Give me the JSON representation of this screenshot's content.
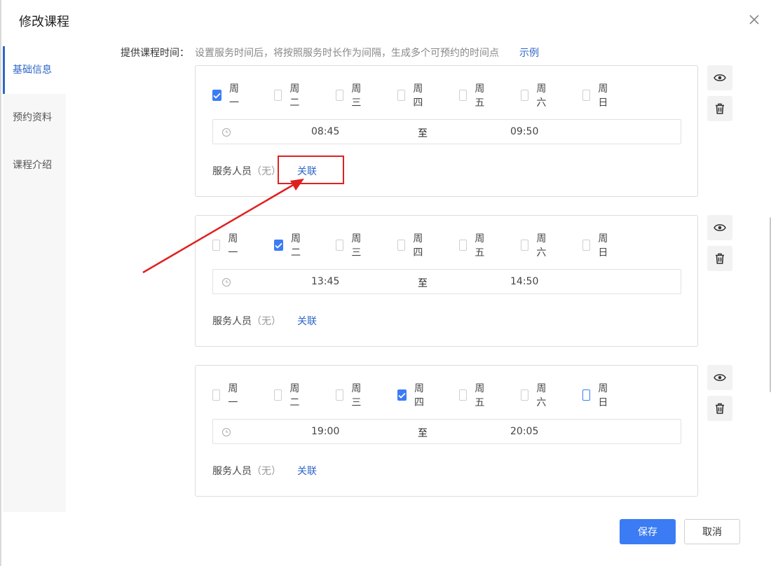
{
  "dialog": {
    "title": "修改课程"
  },
  "sidebar": {
    "items": [
      {
        "label": "基础信息",
        "active": true
      },
      {
        "label": "预约资料",
        "active": false
      },
      {
        "label": "课程介绍",
        "active": false
      }
    ]
  },
  "form": {
    "time_label": "提供课程时间：",
    "hint": "设置服务时间后，将按照服务时长作为间隔，生成多个可预约的时间点",
    "example_link": "示例"
  },
  "weekdays": [
    "周一",
    "周二",
    "周三",
    "周四",
    "周五",
    "周六",
    "周日"
  ],
  "slots": [
    {
      "checked_day": "周一",
      "start": "08:45",
      "separator": "至",
      "end": "09:50",
      "staff_label": "服务人员",
      "staff_value": "（无）",
      "link": "关联"
    },
    {
      "checked_day": "周二",
      "start": "13:45",
      "separator": "至",
      "end": "14:50",
      "staff_label": "服务人员",
      "staff_value": "（无）",
      "link": "关联"
    },
    {
      "checked_day": "周四",
      "start": "19:00",
      "separator": "至",
      "end": "20:05",
      "staff_label": "服务人员",
      "staff_value": "（无）",
      "link": "关联",
      "focused_day": "周日"
    }
  ],
  "footer": {
    "save": "保存",
    "cancel": "取消"
  },
  "colors": {
    "accent": "#3b7cf5",
    "link": "#2d66c9",
    "annotation": "#e02020"
  },
  "icons": {
    "preview": "eye-icon",
    "delete": "trash-icon",
    "close": "close-icon",
    "time": "clock-icon"
  }
}
